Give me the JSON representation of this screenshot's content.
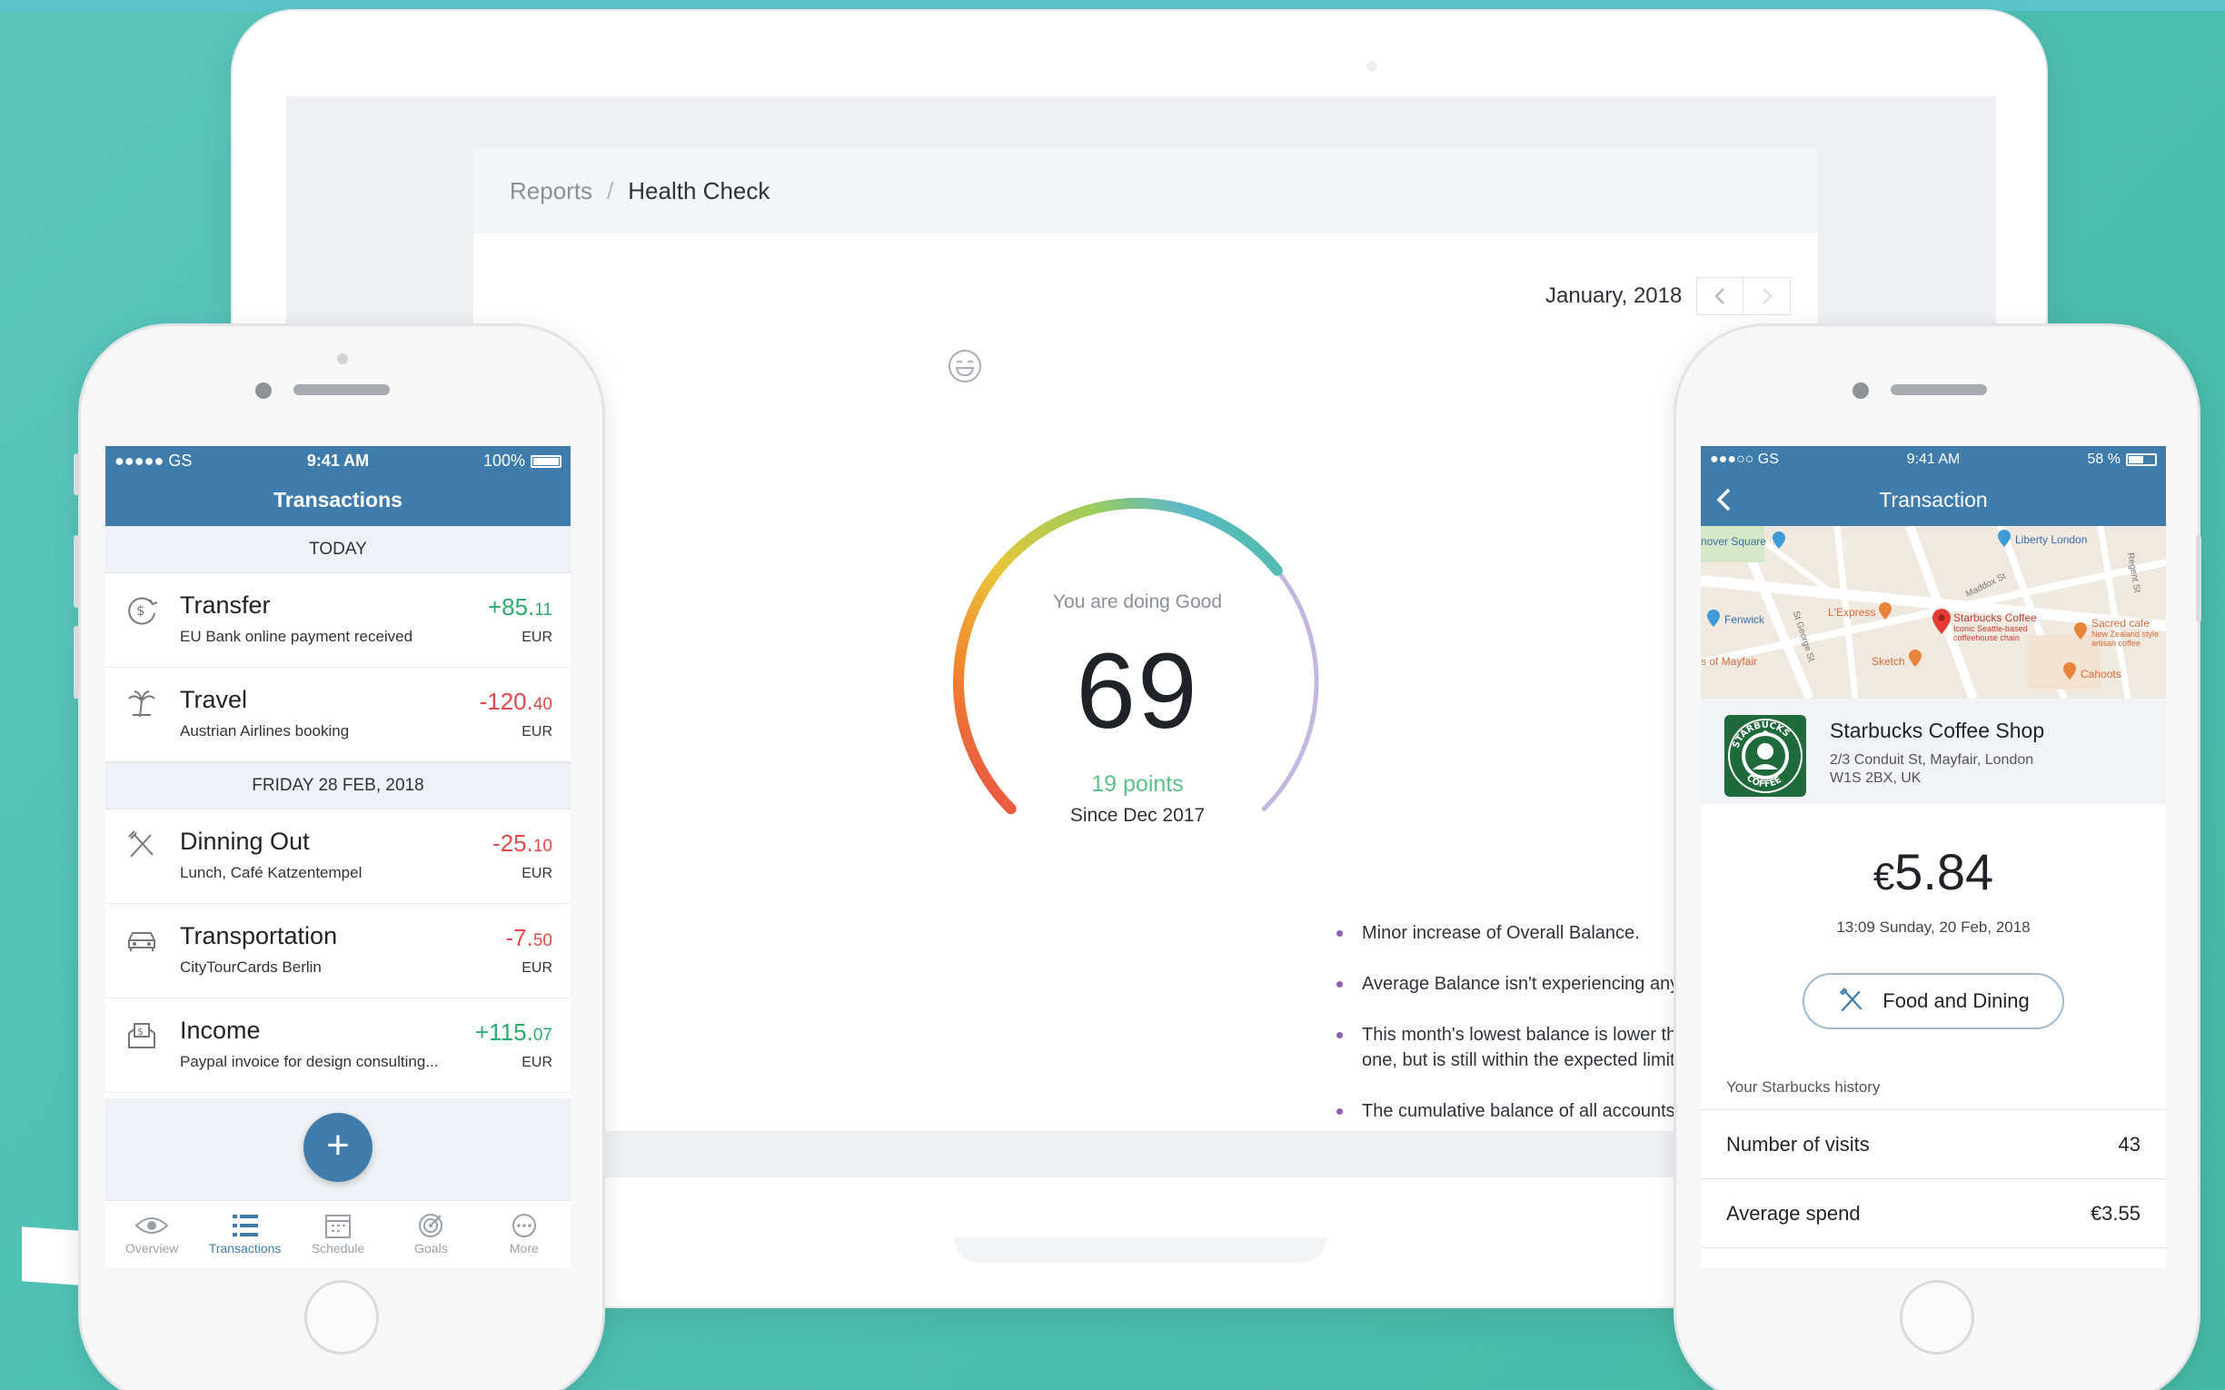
{
  "laptop": {
    "breadcrumb": {
      "parent": "Reports",
      "separator": "/",
      "current": "Health Check"
    },
    "date_nav": {
      "label": "January, 2018",
      "prev": "‹",
      "next": "›"
    },
    "gauge": {
      "status": "You are doing Good",
      "score": "69",
      "score_value": 69,
      "points": "19 points",
      "since": "Since Dec 2017"
    },
    "insights": [
      "Minor increase of Overall Balance.",
      "Average Balance isn't experiencing any major changes.",
      "This month's lowest balance is lower than the previous month's one, but is still within the expected limits.",
      "The cumulative balance of all accounts stayed positive."
    ]
  },
  "left_phone": {
    "status": {
      "carrier": "●●●●● GS",
      "time": "9:41 AM",
      "battery": "100%",
      "battery_level": 1.0
    },
    "title": "Transactions",
    "sections": [
      {
        "header": "TODAY",
        "items": [
          {
            "icon": "transfer-icon",
            "title": "Transfer",
            "subtitle": "EU Bank online payment received",
            "amount_main": "+85.",
            "amount_cents": "11",
            "currency": "EUR",
            "sign": "pos"
          },
          {
            "icon": "palm-tree-icon",
            "title": "Travel",
            "subtitle": "Austrian Airlines booking",
            "amount_main": "-120.",
            "amount_cents": "40",
            "currency": "EUR",
            "sign": "neg"
          }
        ]
      },
      {
        "header": "FRIDAY  28 FEB, 2018",
        "items": [
          {
            "icon": "cutlery-icon",
            "title": "Dinning Out",
            "subtitle": "Lunch, Café Katzentempel",
            "amount_main": "-25.",
            "amount_cents": "10",
            "currency": "EUR",
            "sign": "neg"
          },
          {
            "icon": "car-icon",
            "title": "Transportation",
            "subtitle": "CityTourCards Berlin",
            "amount_main": "-7.",
            "amount_cents": "50",
            "currency": "EUR",
            "sign": "neg"
          },
          {
            "icon": "income-icon",
            "title": "Income",
            "subtitle": "Paypal invoice for design consulting...",
            "amount_main": "+115.",
            "amount_cents": "07",
            "currency": "EUR",
            "sign": "pos"
          }
        ]
      }
    ],
    "fab": "+",
    "tabs": [
      {
        "label": "Overview",
        "icon": "eye-icon",
        "active": false
      },
      {
        "label": "Transactions",
        "icon": "list-icon",
        "active": true
      },
      {
        "label": "Schedule",
        "icon": "calendar-icon",
        "active": false
      },
      {
        "label": "Goals",
        "icon": "target-icon",
        "active": false
      },
      {
        "label": "More",
        "icon": "more-icon",
        "active": false
      }
    ]
  },
  "right_phone": {
    "status": {
      "carrier": "●●●○○ GS",
      "time": "9:41 AM",
      "battery": "58 %",
      "battery_level": 0.58
    },
    "title": "Transaction",
    "map_labels": {
      "hanover": "nover Square",
      "liberty": "Liberty London",
      "fenwick": "Fenwick",
      "lexpress": "L'Express",
      "starbucks": "Starbucks Coffee",
      "starbucks_sub": "Iconic Seattle-based coffeehouse chain",
      "sacred": "Sacred cafe",
      "sacred_sub": "New Zealand style artisan coffee",
      "mayfair": "s of Mayfair",
      "sketch": "Sketch",
      "cahoots": "Cahoots",
      "street_1": "St George St",
      "street_2": "Maddox St",
      "street_3": "Regent St"
    },
    "merchant": {
      "name": "Starbucks Coffee Shop",
      "address_line1": "2/3 Conduit St, Mayfair, London",
      "address_line2": "W1S 2BX, UK",
      "logo_text_top": "STARBUCKS",
      "logo_text_bottom": "COFFEE"
    },
    "amount_currency": "€",
    "amount": "5.84",
    "datetime": "13:09 Sunday, 20 Feb, 2018",
    "category": "Food and Dining",
    "history_title": "Your Starbucks history",
    "history": [
      {
        "label": "Number of visits",
        "value": "43"
      },
      {
        "label": "Average spend",
        "value": "€3.55"
      }
    ]
  }
}
